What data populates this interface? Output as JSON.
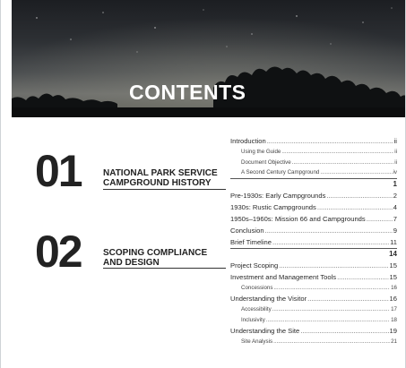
{
  "header": {
    "title": "CONTENTS"
  },
  "sections": [
    {
      "number": "01",
      "title_line1": "NATIONAL PARK SERVICE",
      "title_line2": "CAMPGROUND HISTORY"
    },
    {
      "number": "02",
      "title_line1": "SCOPING COMPLIANCE",
      "title_line2": "AND DESIGN"
    }
  ],
  "toc": {
    "group1": [
      {
        "title": "Introduction",
        "page": "ii"
      },
      {
        "title": "Using the Guide",
        "page": "ii",
        "sub": true
      },
      {
        "title": "Document Objective",
        "page": "ii",
        "sub": true
      },
      {
        "title": "A Second Century Campground",
        "page": "iv",
        "sub": true
      }
    ],
    "group1_page": "1",
    "group2": [
      {
        "title": "Pre-1930s: Early Campgrounds",
        "page": "2"
      },
      {
        "title": "1930s: Rustic Campgrounds",
        "page": "4"
      },
      {
        "title": "1950s–1960s: Mission 66 and Campgrounds",
        "page": "7"
      },
      {
        "title": "Conclusion",
        "page": "9"
      },
      {
        "title": "Brief Timeline",
        "page": "11"
      }
    ],
    "group2_page": "14",
    "group3": [
      {
        "title": "Project Scoping",
        "page": "15"
      },
      {
        "title": "Investment and Management Tools",
        "page": "15"
      },
      {
        "title": "Concessions",
        "page": "16",
        "sub": true
      },
      {
        "title": "Understanding the Visitor",
        "page": "16"
      },
      {
        "title": "Accessibility",
        "page": "17",
        "sub": true
      },
      {
        "title": "Inclusivity",
        "page": "18",
        "sub": true
      },
      {
        "title": "Understanding the Site",
        "page": "19"
      },
      {
        "title": "Site Analysis",
        "page": "21",
        "sub": true
      }
    ]
  }
}
